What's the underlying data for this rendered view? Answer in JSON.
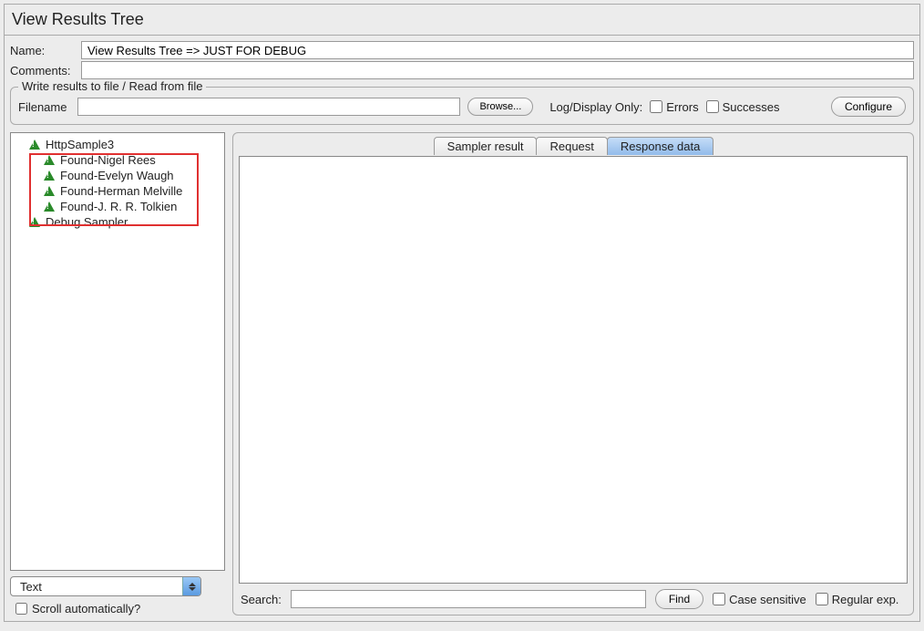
{
  "header": {
    "title": "View Results Tree"
  },
  "form": {
    "name_label": "Name:",
    "name_value": "View Results Tree => JUST FOR DEBUG",
    "comments_label": "Comments:",
    "comments_value": ""
  },
  "file_section": {
    "legend": "Write results to file / Read from file",
    "filename_label": "Filename",
    "filename_value": "",
    "browse_label": "Browse...",
    "logdisplay_label": "Log/Display Only:",
    "errors_label": "Errors",
    "successes_label": "Successes",
    "configure_label": "Configure"
  },
  "tree": {
    "items": [
      {
        "label": "HttpSample3",
        "child": false
      },
      {
        "label": "Found-Nigel Rees",
        "child": true
      },
      {
        "label": "Found-Evelyn Waugh",
        "child": true
      },
      {
        "label": "Found-Herman Melville",
        "child": true
      },
      {
        "label": "Found-J. R. R. Tolkien",
        "child": true
      },
      {
        "label": "Debug Sampler",
        "child": false
      }
    ],
    "renderer_selected": "Text",
    "scroll_label": "Scroll automatically?"
  },
  "tabs": {
    "sampler": "Sampler result",
    "request": "Request",
    "response": "Response data",
    "active": "response"
  },
  "search": {
    "label": "Search:",
    "value": "",
    "find_label": "Find",
    "case_label": "Case sensitive",
    "regex_label": "Regular exp."
  }
}
